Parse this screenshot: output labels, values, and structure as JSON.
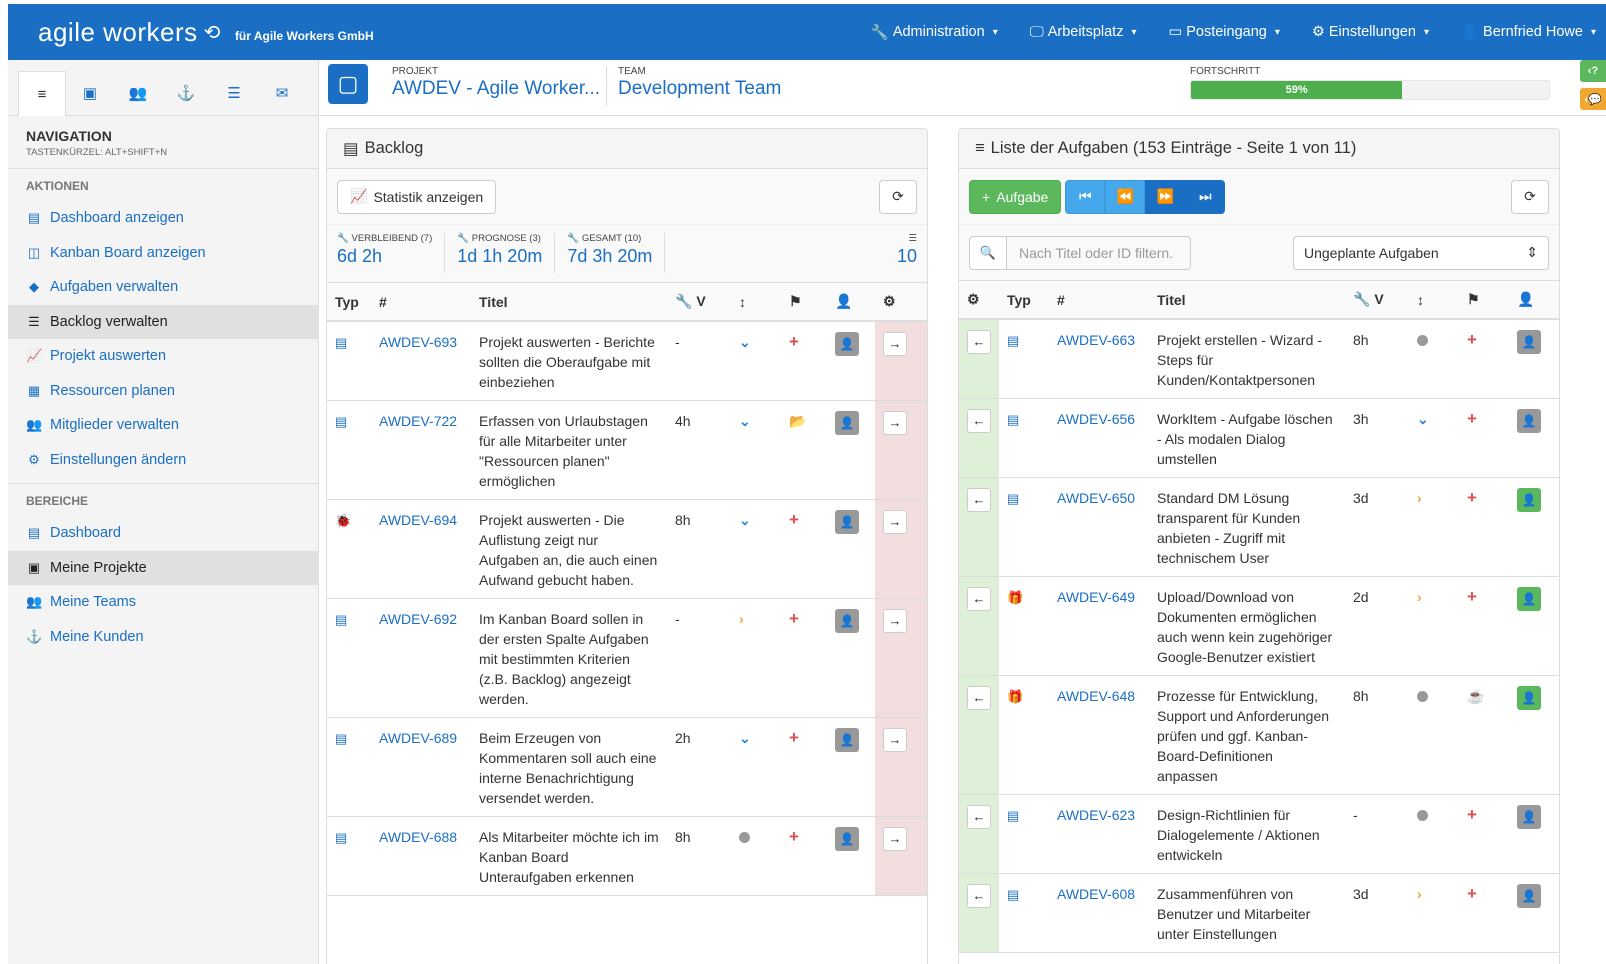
{
  "topbar": {
    "logo": "agile workers",
    "company": "für Agile Workers GmbH",
    "nav": [
      {
        "icon": "wrench-icon",
        "label": "Administration"
      },
      {
        "icon": "desktop-icon",
        "label": "Arbeitsplatz"
      },
      {
        "icon": "inbox-icon",
        "label": "Posteingang"
      },
      {
        "icon": "gear-icon",
        "label": "Einstellungen"
      },
      {
        "icon": "user-icon",
        "label": "Bernfried Howe"
      }
    ]
  },
  "sidebar": {
    "tabs": [
      "menu-icon",
      "briefcase-icon",
      "team-icon",
      "customer-icon",
      "list-icon",
      "envelope-icon"
    ],
    "nav_title": "NAVIGATION",
    "nav_shortcut": "TASTENKÜRZEL: ALT+SHIFT+N",
    "actions_label": "AKTIONEN",
    "actions": [
      {
        "icon": "dashboard-icon",
        "label": "Dashboard anzeigen"
      },
      {
        "icon": "kanban-icon",
        "label": "Kanban Board anzeigen"
      },
      {
        "icon": "tag-icon",
        "label": "Aufgaben verwalten"
      },
      {
        "icon": "list-icon",
        "label": "Backlog verwalten",
        "active": true
      },
      {
        "icon": "chart-icon",
        "label": "Projekt auswerten"
      },
      {
        "icon": "calendar-icon",
        "label": "Ressourcen planen"
      },
      {
        "icon": "team-icon",
        "label": "Mitglieder verwalten"
      },
      {
        "icon": "gears-icon",
        "label": "Einstellungen ändern"
      }
    ],
    "areas_label": "BEREICHE",
    "areas": [
      {
        "icon": "dashboard-icon",
        "label": "Dashboard"
      },
      {
        "icon": "briefcase-icon",
        "label": "Meine Projekte",
        "active": true
      },
      {
        "icon": "team-icon",
        "label": "Meine Teams"
      },
      {
        "icon": "customer-icon",
        "label": "Meine Kunden"
      }
    ]
  },
  "header": {
    "project_label": "PROJEKT",
    "project": "AWDEV - Agile Worker...",
    "team_label": "TEAM",
    "team": "Development Team",
    "progress_label": "FORTSCHRITT",
    "progress_text": "59%",
    "progress_value": 0.59,
    "help": "?"
  },
  "backlog": {
    "title": "Backlog",
    "stats_button": "Statistik anzeigen",
    "stats": [
      {
        "label": "VERBLEIBEND (7)",
        "value": "6d 2h"
      },
      {
        "label": "PROGNOSE (3)",
        "value": "1d 1h 20m"
      },
      {
        "label": "GESAMT (10)",
        "value": "7d 3h 20m"
      }
    ],
    "count": "10",
    "columns": {
      "typ": "Typ",
      "id": "#",
      "title": "Titel",
      "v": "V"
    },
    "rows": [
      {
        "type": "story",
        "id": "AWDEV-693",
        "title": "Projekt auswerten - Berichte sollten die Oberaufgabe mit einbeziehen",
        "effort": "-",
        "prio": "down",
        "status": "plus"
      },
      {
        "type": "story",
        "id": "AWDEV-722",
        "title": "Erfassen von Urlaubstagen für alle Mitarbeiter unter \"Ressourcen planen\" ermöglichen",
        "effort": "4h",
        "prio": "down",
        "status": "folder"
      },
      {
        "type": "bug",
        "id": "AWDEV-694",
        "title": "Projekt auswerten - Die Auflistung zeigt nur Aufgaben an, die auch einen Aufwand gebucht haben.",
        "effort": "8h",
        "prio": "down",
        "status": "plus"
      },
      {
        "type": "story",
        "id": "AWDEV-692",
        "title": "Im Kanban Board sollen in der ersten Spalte Aufgaben mit bestimmten Kriterien (z.B. Backlog) angezeigt werden.",
        "effort": "-",
        "prio": "right",
        "status": "plus"
      },
      {
        "type": "story",
        "id": "AWDEV-689",
        "title": "Beim Erzeugen von Kommentaren soll auch eine interne Benachrichtigung versendet werden.",
        "effort": "2h",
        "prio": "down",
        "status": "plus"
      },
      {
        "type": "story",
        "id": "AWDEV-688",
        "title": "Als Mitarbeiter möchte ich im Kanban Board Unteraufgaben erkennen",
        "effort": "8h",
        "prio": "dot",
        "status": "plus"
      }
    ]
  },
  "tasks": {
    "title": "Liste der Aufgaben (153 Einträge - Seite 1 von 11)",
    "add_button": "Aufgabe",
    "filter_placeholder": "Nach Titel oder ID filtern.",
    "filter_select": "Ungeplante Aufgaben",
    "columns": {
      "typ": "Typ",
      "id": "#",
      "title": "Titel",
      "v": "V"
    },
    "rows": [
      {
        "type": "story",
        "id": "AWDEV-663",
        "title": "Projekt erstellen - Wizard - Steps für Kunden/Kontaktpersonen",
        "effort": "8h",
        "prio": "dot",
        "status": "plus",
        "assignee": "grey"
      },
      {
        "type": "story",
        "id": "AWDEV-656",
        "title": "WorkItem - Aufgabe löschen - Als modalen Dialog umstellen",
        "effort": "3h",
        "prio": "down",
        "status": "plus",
        "assignee": "grey"
      },
      {
        "type": "story",
        "id": "AWDEV-650",
        "title": "Standard DM Lösung transparent für Kunden anbieten - Zugriff mit technischem User",
        "effort": "3d",
        "prio": "right",
        "status": "plus",
        "assignee": "green"
      },
      {
        "type": "gift",
        "id": "AWDEV-649",
        "title": "Upload/Download von Dokumenten ermöglichen auch wenn kein zugehöriger Google-Benutzer existiert",
        "effort": "2d",
        "prio": "right",
        "status": "plus",
        "assignee": "green"
      },
      {
        "type": "gift",
        "id": "AWDEV-648",
        "title": "Prozesse für Entwicklung, Support und Anforderungen prüfen und ggf. Kanban-Board-Definitionen anpassen",
        "effort": "8h",
        "prio": "dot",
        "status": "cup",
        "assignee": "green"
      },
      {
        "type": "story",
        "id": "AWDEV-623",
        "title": "Design-Richtlinien für Dialogelemente / Aktionen entwickeln",
        "effort": "-",
        "prio": "dot",
        "status": "plus",
        "assignee": "grey"
      },
      {
        "type": "story",
        "id": "AWDEV-608",
        "title": "Zusammenführen von Benutzer und Mitarbeiter unter Einstellungen",
        "effort": "3d",
        "prio": "right",
        "status": "plus",
        "assignee": "grey"
      }
    ]
  }
}
